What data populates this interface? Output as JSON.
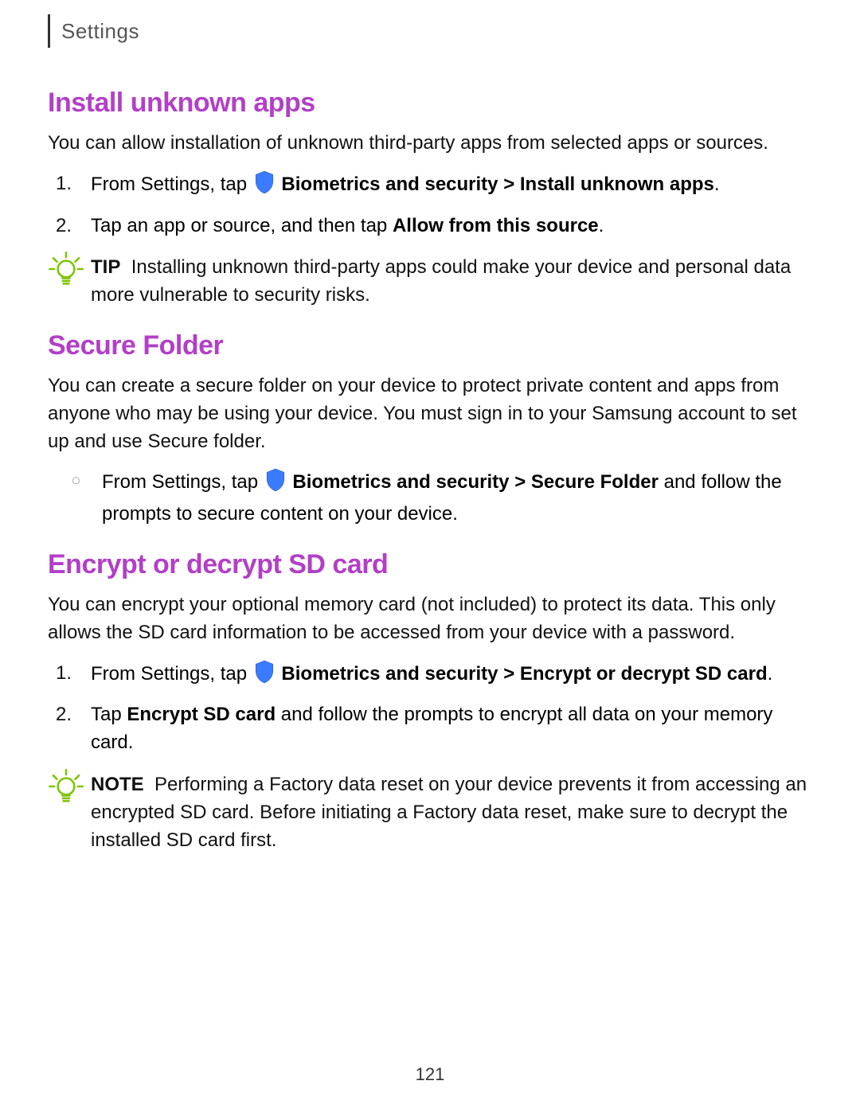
{
  "header": {
    "title": "Settings"
  },
  "page_number": "121",
  "sections": [
    {
      "heading": "Install unknown apps",
      "intro": "You can allow installation of unknown third-party apps from selected apps or sources.",
      "steps": [
        {
          "prefix": "From Settings, tap ",
          "has_shield": true,
          "bold": "Biometrics and security > Install unknown apps",
          "suffix": "."
        },
        {
          "prefix": "Tap an app or source, and then tap ",
          "has_shield": false,
          "bold": "Allow from this source",
          "suffix": "."
        }
      ],
      "callout": {
        "label": "TIP",
        "text": "Installing unknown third-party apps could make your device and personal data more vulnerable to security risks."
      }
    },
    {
      "heading": "Secure Folder",
      "intro": "You can create a secure folder on your device to protect private content and apps from anyone who may be using your device. You must sign in to your Samsung account to set up and use Secure folder.",
      "circ_item": {
        "prefix": "From Settings, tap ",
        "has_shield": true,
        "bold": "Biometrics and security > Secure Folder",
        "suffix": " and follow the prompts to secure content on your device."
      }
    },
    {
      "heading": "Encrypt or decrypt SD card",
      "intro": "You can encrypt your optional memory card (not included) to protect its data. This only allows the SD card information to be accessed from your device with a password.",
      "steps": [
        {
          "prefix": "From Settings, tap ",
          "has_shield": true,
          "bold": "Biometrics and security > Encrypt or decrypt SD card",
          "suffix": "."
        },
        {
          "prefix": "Tap ",
          "has_shield": false,
          "bold": "Encrypt SD card",
          "suffix": " and follow the prompts to encrypt all data on your memory card."
        }
      ],
      "callout": {
        "label": "NOTE",
        "text": "Performing a Factory data reset on your device prevents it from accessing an encrypted SD card. Before initiating a Factory data reset, make sure to decrypt the installed SD card first."
      }
    }
  ]
}
